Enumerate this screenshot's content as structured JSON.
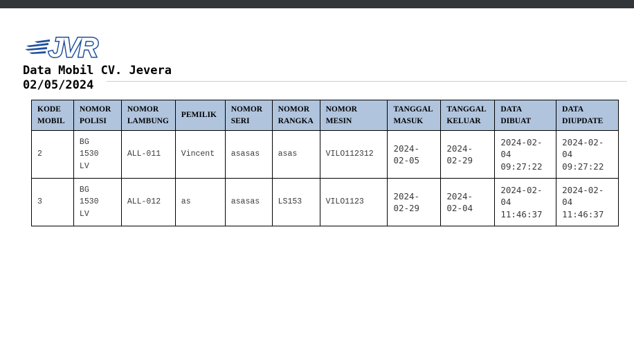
{
  "logo": {
    "text": "JVR",
    "color": "#1e4f9c"
  },
  "report": {
    "title": "Data Mobil CV. Jevera",
    "date": "02/05/2024"
  },
  "table": {
    "header_color": "#b0c4de",
    "headers": {
      "kode": [
        "KODE",
        "MOBIL"
      ],
      "polisi": [
        "NOMOR",
        "POLISI"
      ],
      "lambung": [
        "NOMOR",
        "LAMBUNG"
      ],
      "pemilik": [
        "PEMILIK"
      ],
      "seri": [
        "NOMOR",
        "SERI"
      ],
      "rangka": [
        "NOMOR",
        "RANGKA"
      ],
      "mesin": [
        "NOMOR",
        "MESIN"
      ],
      "masuk": [
        "TANGGAL",
        "MASUK"
      ],
      "keluar": [
        "TANGGAL",
        "KELUAR"
      ],
      "dibuat": [
        "DATA",
        "DIBUAT"
      ],
      "diupdate": [
        "DATA",
        "DIUPDATE"
      ]
    },
    "rows": [
      {
        "kode": "2",
        "polisi": [
          "BG",
          "1530",
          "LV"
        ],
        "lambung": "ALL-011",
        "pemilik": "Vincent",
        "seri": "asasas",
        "rangka": "asas",
        "mesin": "VILO112312",
        "masuk": [
          "2024-",
          "02-05"
        ],
        "keluar": [
          "2024-",
          "02-29"
        ],
        "dibuat": [
          "2024-02-",
          "04",
          "09:27:22"
        ],
        "diupdate": [
          "2024-02-",
          "04",
          "09:27:22"
        ]
      },
      {
        "kode": "3",
        "polisi": [
          "BG",
          "1530",
          "LV"
        ],
        "lambung": "ALL-012",
        "pemilik": "as",
        "seri": "asasas",
        "rangka": "LS153",
        "mesin": "VILO1123",
        "masuk": [
          "2024-",
          "02-29"
        ],
        "keluar": [
          "2024-",
          "02-04"
        ],
        "dibuat": [
          "2024-02-",
          "04",
          "11:46:37"
        ],
        "diupdate": [
          "2024-02-",
          "04",
          "11:46:37"
        ]
      }
    ]
  }
}
